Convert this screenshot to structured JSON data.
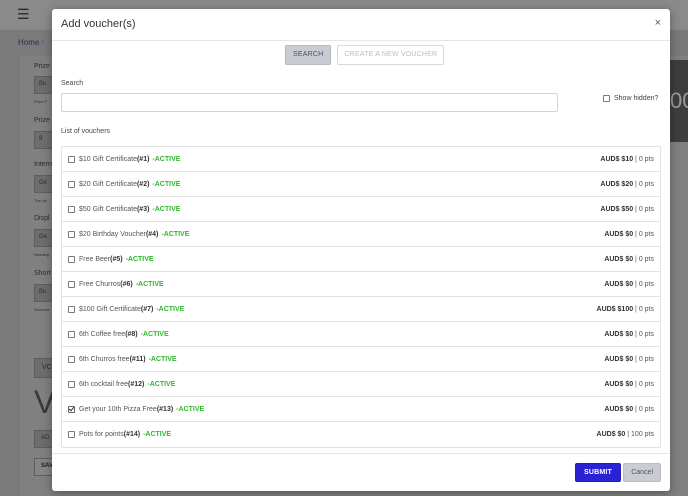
{
  "background": {
    "breadcrumb_home": "Home",
    "breadcrumb_sep": "/",
    "labels": [
      "Prize",
      "Prize",
      "Intern",
      "Displ",
      "Short"
    ],
    "inputs": [
      "Bu",
      "9",
      "Ge",
      "Ge",
      "Bu"
    ],
    "tiny_notes": [
      "Prize P",
      "The Va",
      "Heading",
      "Summar"
    ],
    "tab_label": "VC",
    "large_letter": "V",
    "add_label": "AD",
    "save_label": "SAV",
    "dark_panel_text": "00"
  },
  "modal": {
    "title": "Add voucher(s)",
    "close_icon": "×",
    "search_button": "SEARCH",
    "create_button": "CREATE A NEW VOUCHER",
    "search_label": "Search",
    "search_value": "",
    "show_hidden_label": "Show hidden?",
    "list_label": "List of vouchers",
    "vouchers": [
      {
        "name": "$10 Gift Certificate",
        "code": "(#1)",
        "status": "-ACTIVE",
        "price": "AUD$ $10",
        "pts": " | 0 pts",
        "checked": false
      },
      {
        "name": "$20 Gift Certificate",
        "code": "(#2)",
        "status": "-ACTIVE",
        "price": "AUD$ $20",
        "pts": " | 0 pts",
        "checked": false
      },
      {
        "name": "$50 Gift Certificate",
        "code": "(#3)",
        "status": "-ACTIVE",
        "price": "AUD$ $50",
        "pts": " | 0 pts",
        "checked": false
      },
      {
        "name": "$20 Birthday Voucher",
        "code": "(#4)",
        "status": "-ACTIVE",
        "price": "AUD$ $0",
        "pts": " | 0 pts",
        "checked": false
      },
      {
        "name": "Free Beer",
        "code": "(#5)",
        "status": "-ACTIVE",
        "price": "AUD$ $0",
        "pts": " | 0 pts",
        "checked": false
      },
      {
        "name": "Free Churros",
        "code": "(#6)",
        "status": "-ACTIVE",
        "price": "AUD$ $0",
        "pts": " | 0 pts",
        "checked": false
      },
      {
        "name": "$100 Gift Certificate",
        "code": "(#7)",
        "status": "-ACTIVE",
        "price": "AUD$ $100",
        "pts": " | 0 pts",
        "checked": false
      },
      {
        "name": "6th Coffee free",
        "code": "(#8)",
        "status": "-ACTIVE",
        "price": "AUD$ $0",
        "pts": " | 0 pts",
        "checked": false
      },
      {
        "name": "6th Churros free",
        "code": "(#11)",
        "status": "-ACTIVE",
        "price": "AUD$ $0",
        "pts": " | 0 pts",
        "checked": false
      },
      {
        "name": "6th cocktail free",
        "code": "(#12)",
        "status": "-ACTIVE",
        "price": "AUD$ $0",
        "pts": " | 0 pts",
        "checked": false
      },
      {
        "name": "Get your 10th Pizza Free",
        "code": "(#13)",
        "status": "-ACTIVE",
        "price": "AUD$ $0",
        "pts": " | 0 pts",
        "checked": true
      },
      {
        "name": "Pots for points",
        "code": "(#14)",
        "status": "-ACTIVE",
        "price": "AUD$ $0",
        "pts": " | 100 pts",
        "checked": false
      }
    ],
    "submit_button": "SUBMIT",
    "cancel_button": "Cancel"
  },
  "colors": {
    "active_status": "#2eb82e",
    "submit_bg": "#2b22d6",
    "overlay": "#7a7a7a"
  }
}
